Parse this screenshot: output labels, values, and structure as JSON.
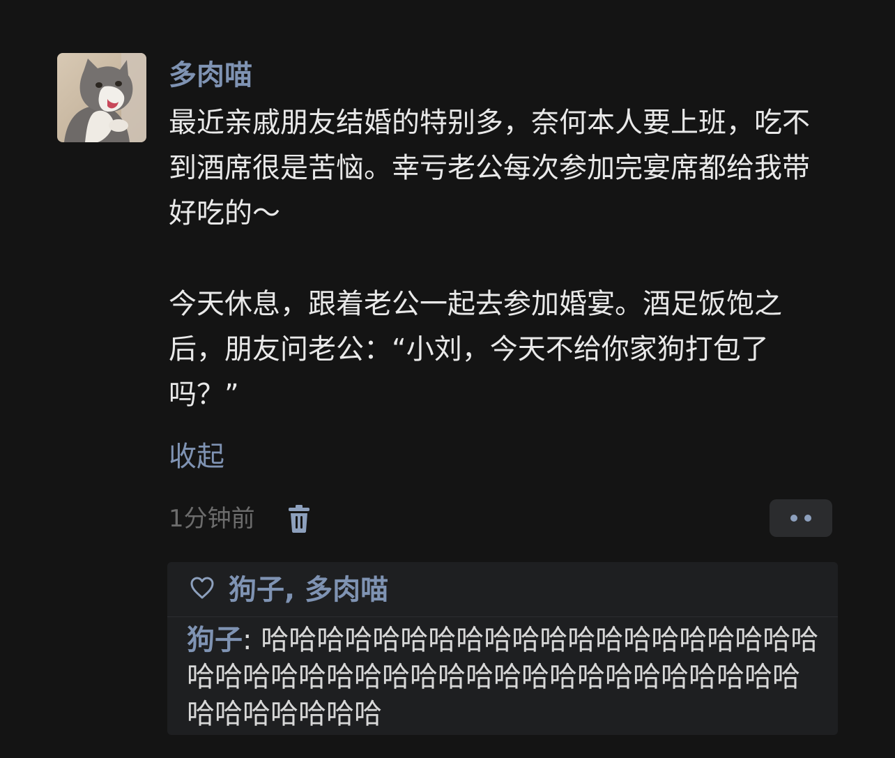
{
  "post": {
    "author": "多肉喵",
    "text": "最近亲戚朋友结婚的特别多，奈何本人要上班，吃不到酒席很是苦恼。幸亏老公每次参加完宴席都给我带好吃的～\n\n今天休息，跟着老公一起去参加婚宴。酒足饭饱之后，朋友问老公：“小刘，今天不给你家狗打包了吗？”",
    "collapse_label": "收起",
    "timestamp": "1分钟前"
  },
  "interactions": {
    "likers": "狗子, 多肉喵",
    "comments": [
      {
        "author": "狗子",
        "separator": ": ",
        "text": "哈哈哈哈哈哈哈哈哈哈哈哈哈哈哈哈哈哈哈哈哈哈哈哈哈哈哈哈哈哈哈哈哈哈哈哈哈哈哈哈哈哈哈哈哈哈哈哈哈"
      }
    ]
  },
  "colors": {
    "background": "#141414",
    "link_blue": "#7f93b3",
    "panel": "#1e1f21",
    "body_text": "#e9e9e9",
    "muted": "#6c6c6c"
  },
  "icons": {
    "avatar": "cat-avatar",
    "delete": "trash-icon",
    "more": "more-dots-icon",
    "like": "heart-outline-icon"
  }
}
